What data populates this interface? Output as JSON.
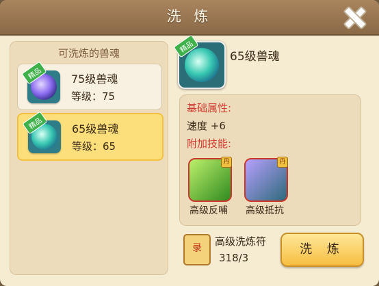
{
  "window": {
    "title": "洗 炼"
  },
  "left_panel": {
    "heading": "可洗炼的兽魂",
    "items": [
      {
        "tag": "精品",
        "name": "75级兽魂",
        "level": "等级：75"
      },
      {
        "tag": "精品",
        "name": "65级兽魂",
        "level": "等级：65"
      }
    ]
  },
  "detail": {
    "tag": "精品",
    "name": "65级兽魂",
    "attr_heading": "基础属性:",
    "attr_value": "速度 +6",
    "skill_heading": "附加技能:",
    "skills": [
      {
        "tag": "丹",
        "label": "高级反哺"
      },
      {
        "tag": "丹",
        "label": "高级抵抗"
      }
    ],
    "item_icon_text": "录",
    "item_name": "高级洗炼符",
    "item_count": "318/3",
    "action_label": "洗 炼"
  }
}
